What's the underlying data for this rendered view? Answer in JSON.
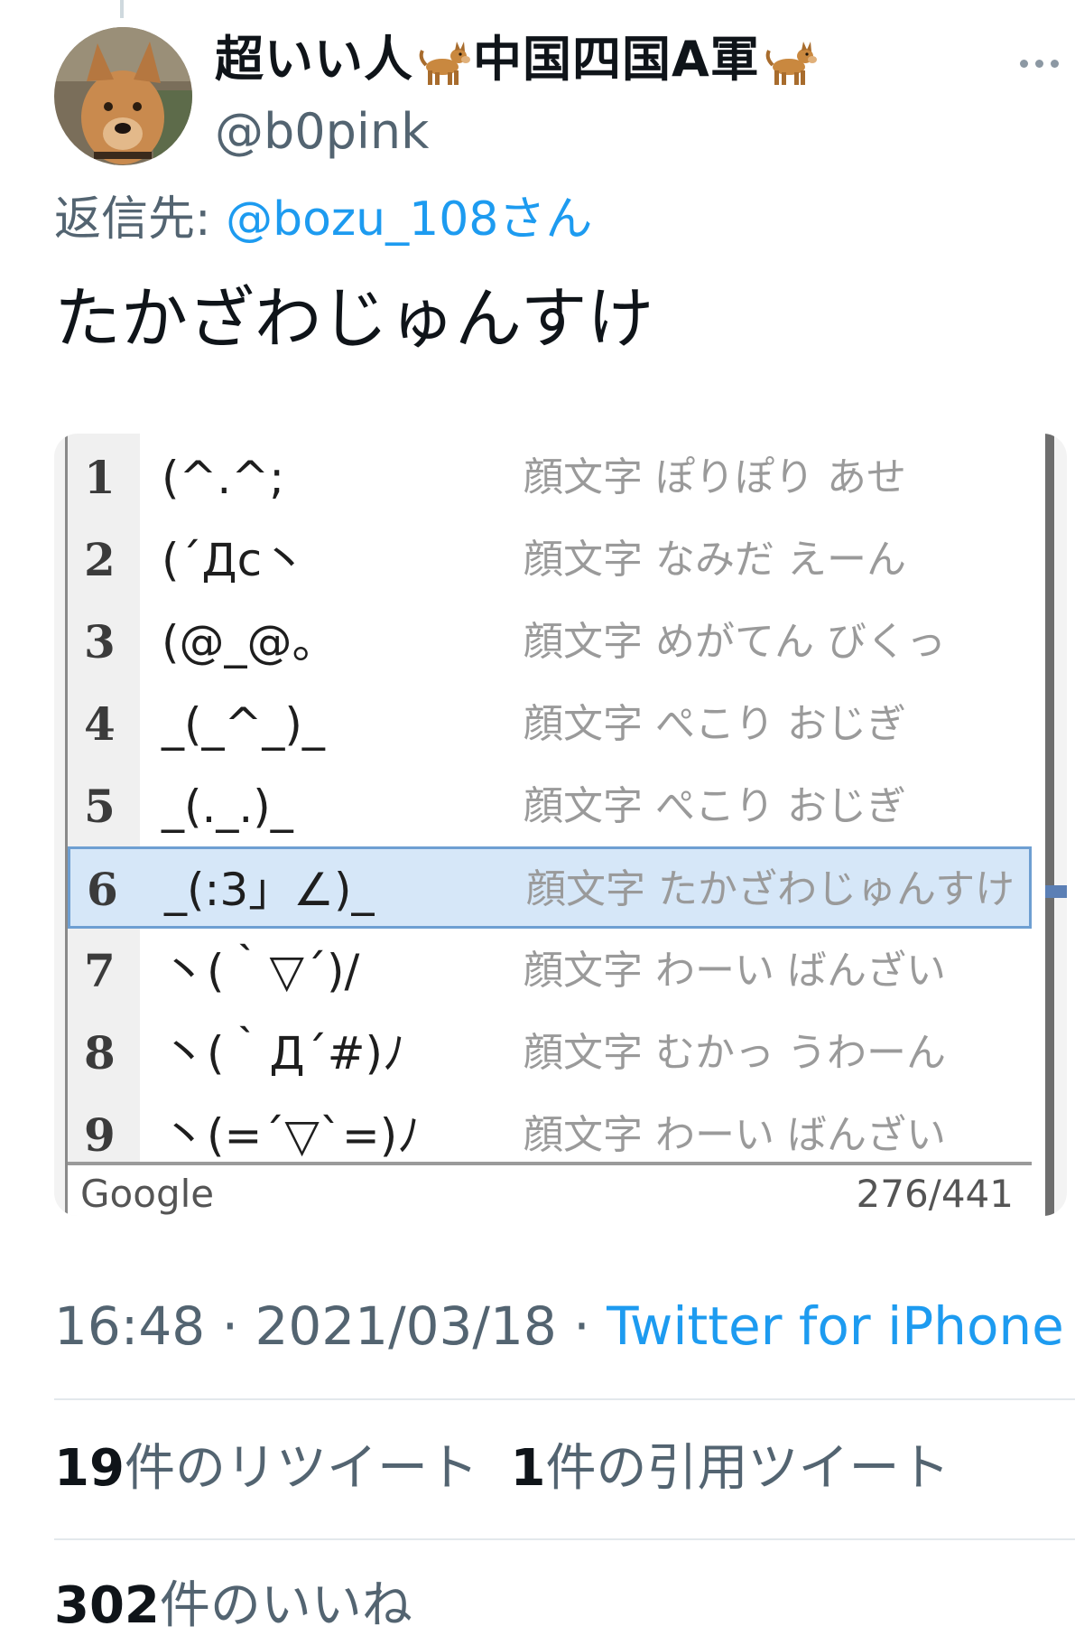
{
  "tweet": {
    "author": {
      "name_parts": [
        "超いい人",
        "中国四国A軍"
      ],
      "emoji": "dog-emoji",
      "handle": "@b0pink"
    },
    "reply": {
      "prefix": "返信先: ",
      "mention": "@bozu_108さん"
    },
    "text": "たかざわじゅんすけ",
    "media": {
      "candidates": [
        {
          "num": "1",
          "kaomoji": "(^.^;",
          "desc": "顔文字 ぽりぽり あせ"
        },
        {
          "num": "2",
          "kaomoji": "(´Дc丶",
          "desc": "顔文字 なみだ えーん"
        },
        {
          "num": "3",
          "kaomoji": "(@_@。",
          "desc": "顔文字 めがてん びくっ"
        },
        {
          "num": "4",
          "kaomoji": "_(_^_)_",
          "desc": "顔文字 ぺこり おじぎ"
        },
        {
          "num": "5",
          "kaomoji": "_(._.)_",
          "desc": "顔文字 ぺこり おじぎ"
        },
        {
          "num": "6",
          "kaomoji": "_(:3」∠)_",
          "desc": "顔文字 たかざわじゅんすけ"
        },
        {
          "num": "7",
          "kaomoji": "丶(｀▽´)/",
          "desc": "顔文字 わーい ばんざい"
        },
        {
          "num": "8",
          "kaomoji": "丶(｀Д´#)ﾉ",
          "desc": "顔文字 むかっ うわーん"
        },
        {
          "num": "9",
          "kaomoji": "丶(=´▽`=)ﾉ",
          "desc": "顔文字 わーい ばんざい"
        }
      ],
      "selected_index": 6,
      "footer_brand": "Google",
      "footer_count": "276/441"
    },
    "meta": {
      "time": "16:48",
      "date": "2021/03/18",
      "separator": " · ",
      "source": "Twitter for iPhone"
    },
    "stats": {
      "retweets_count": "19",
      "retweets_label": "件のリツイート",
      "quotes_count": "1",
      "quotes_label": "件の引用ツイート",
      "likes_count": "302",
      "likes_label": "件のいいね"
    }
  },
  "colors": {
    "link": "#1d9bf0",
    "secondary_text": "#536471",
    "primary_text": "#0f1419",
    "ime_selection": "#d6e7f8"
  },
  "icons": {
    "more": "more-horizontal-icon",
    "avatar": "dog-avatar"
  }
}
